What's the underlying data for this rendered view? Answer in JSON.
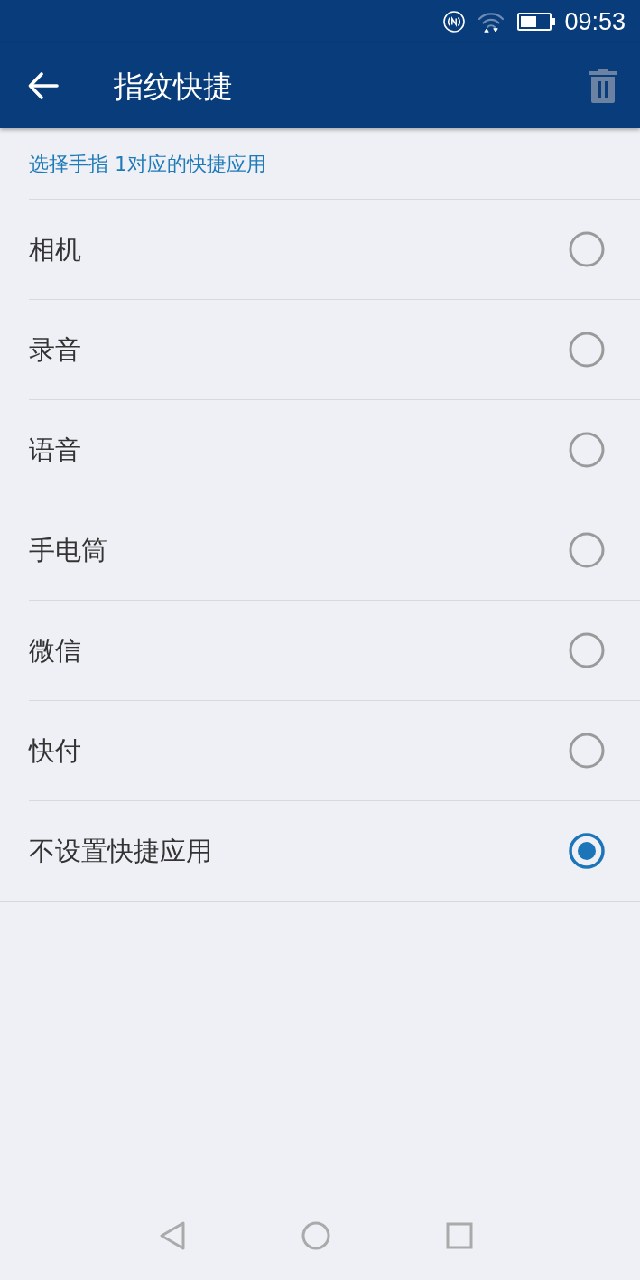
{
  "status_bar": {
    "time": "09:53"
  },
  "app_bar": {
    "title": "指纹快捷",
    "delete_button": {
      "disabled": true
    }
  },
  "subtitle": "选择手指 1对应的快捷应用",
  "options": [
    {
      "label": "相机",
      "selected": false
    },
    {
      "label": "录音",
      "selected": false
    },
    {
      "label": "语音",
      "selected": false
    },
    {
      "label": "手电筒",
      "selected": false
    },
    {
      "label": "微信",
      "selected": false
    },
    {
      "label": "快付",
      "selected": false
    },
    {
      "label": "不设置快捷应用",
      "selected": true
    }
  ]
}
